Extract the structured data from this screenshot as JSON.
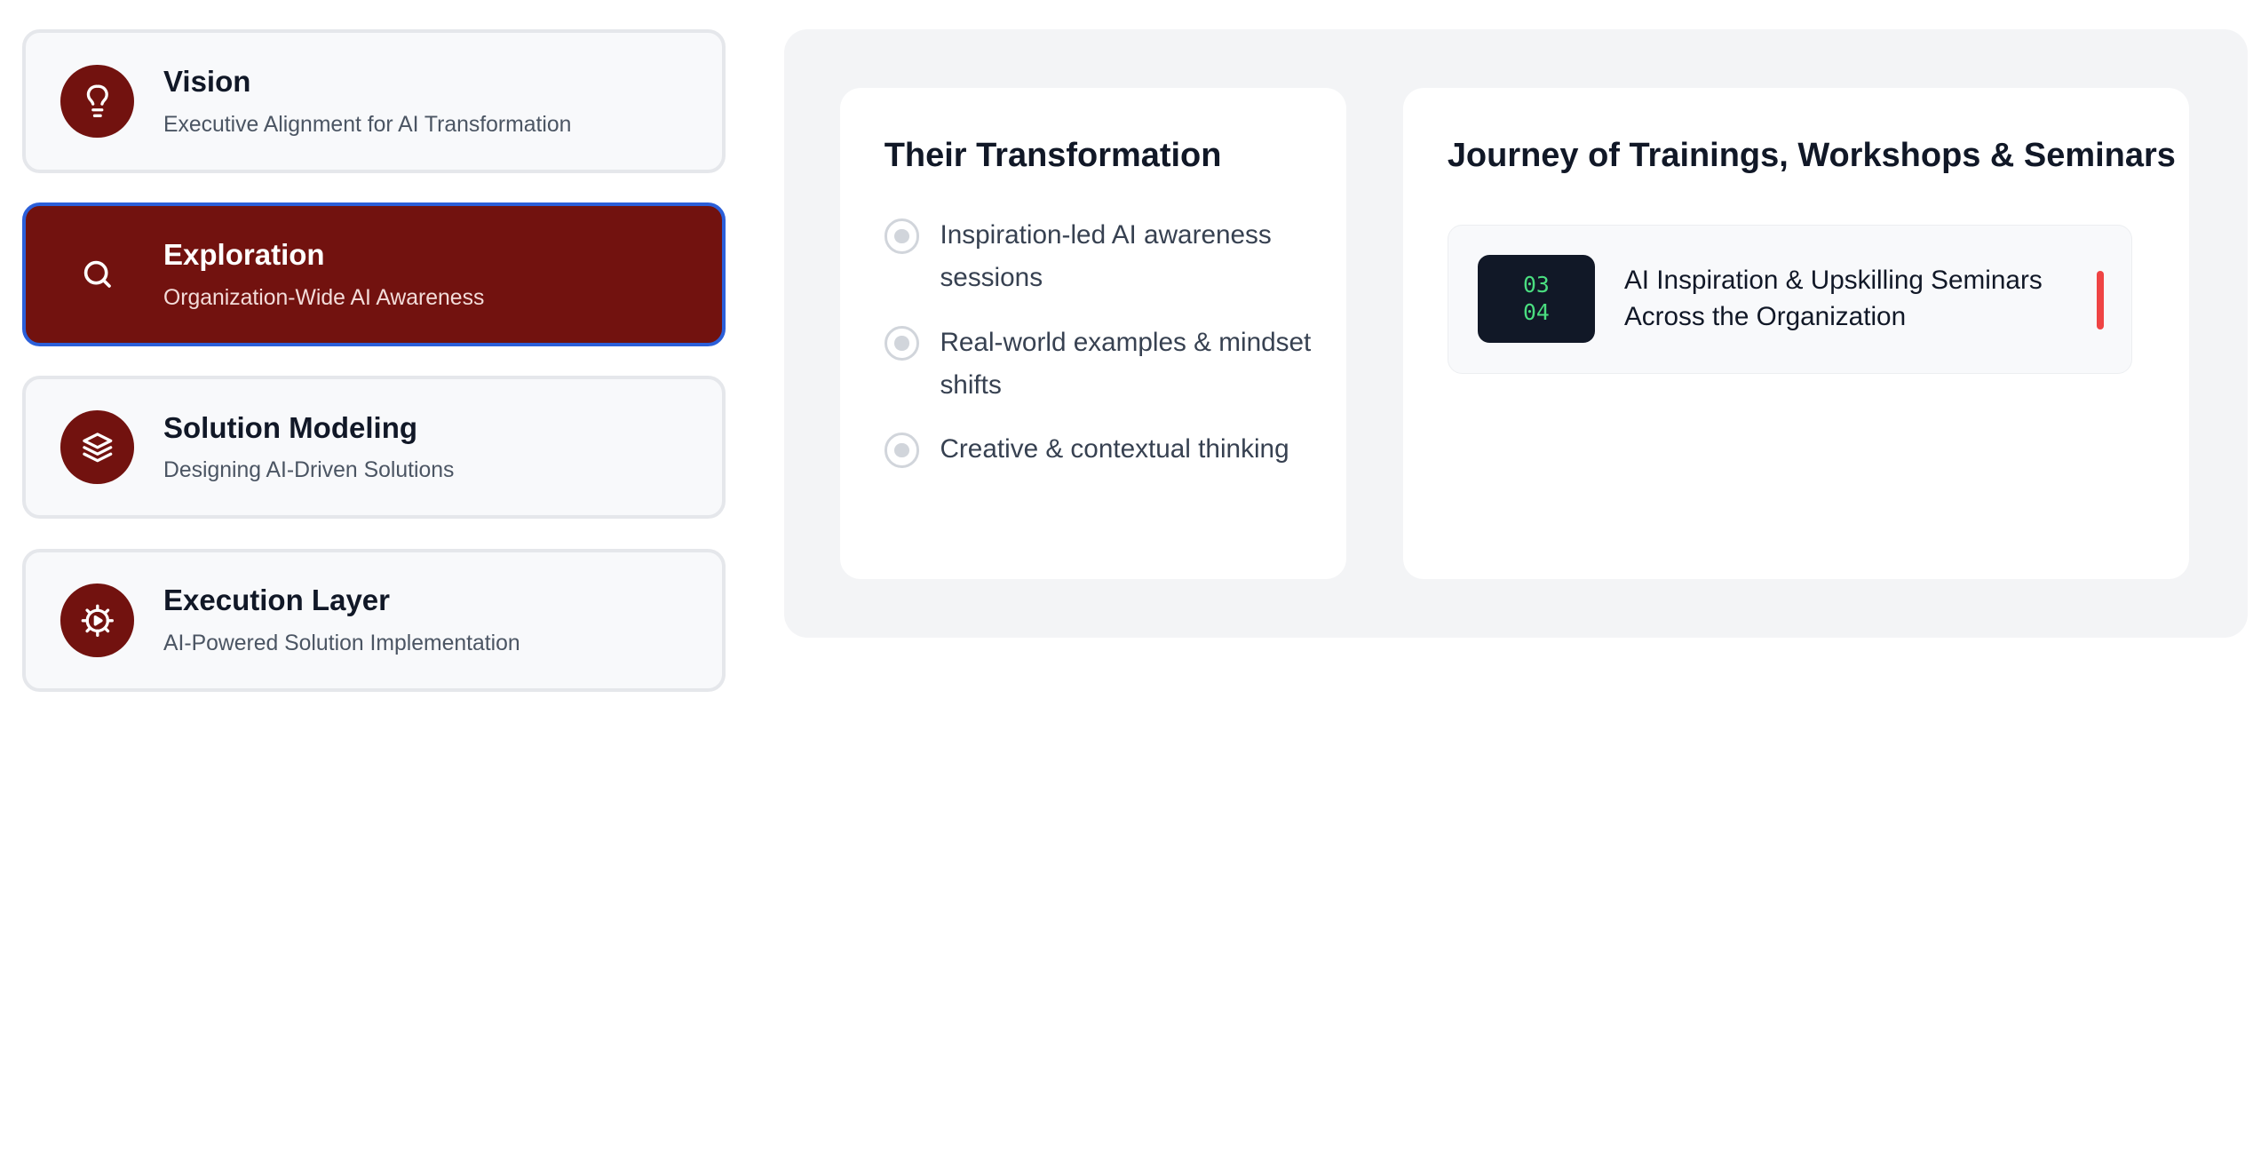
{
  "phases": [
    {
      "title": "Vision",
      "subtitle": "Executive Alignment for AI Transformation",
      "icon": "lightbulb-icon"
    },
    {
      "title": "Exploration",
      "subtitle": "Organization-Wide AI Awareness",
      "icon": "search-icon",
      "active": true
    },
    {
      "title": "Solution Modeling",
      "subtitle": "Designing AI-Driven Solutions",
      "icon": "layers-icon"
    },
    {
      "title": "Execution Layer",
      "subtitle": "AI-Powered Solution Implementation",
      "icon": "gear-play-icon"
    }
  ],
  "transformation": {
    "title": "Their Transformation",
    "items": [
      "Inspiration-led AI awareness sessions",
      "Real-world examples & mindset shifts",
      "Creative & contextual thinking"
    ]
  },
  "journey": {
    "title": "Journey of Trainings, Workshops & Seminars",
    "items": [
      {
        "date_top": "03",
        "date_bottom": "04",
        "text": "AI Inspiration & Upskilling Seminars Across the Organization"
      }
    ]
  },
  "colors": {
    "brand": "#72120f",
    "active_border": "#2b5fd9",
    "accent_bar": "#ef4444",
    "date_text": "#4ade80"
  }
}
